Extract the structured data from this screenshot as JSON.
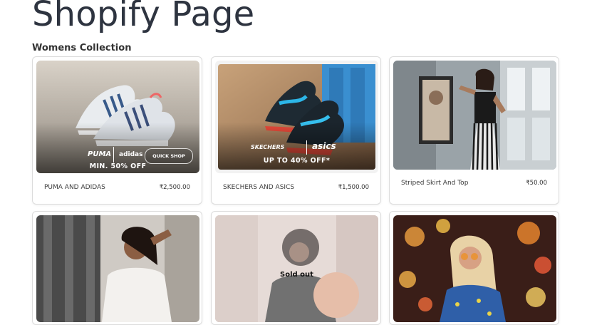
{
  "page": {
    "title": "Shopify Page",
    "section": "Womens Collection"
  },
  "products": [
    {
      "name": "PUMA AND ADIDAS",
      "price": "₹2,500.00",
      "banner": {
        "brands": [
          "PUMA",
          "adidas"
        ],
        "cta": "QUICK SHOP",
        "offer": "MIN. 50% OFF"
      }
    },
    {
      "name": "SKECHERS AND ASICS",
      "price": "₹1,500.00",
      "banner": {
        "brands": [
          "SKECHERS",
          "asics"
        ],
        "offer": "UP TO 40% OFF*"
      }
    },
    {
      "name": "Striped Skirt And Top",
      "price": "₹50.00"
    },
    {
      "name": "",
      "price": ""
    },
    {
      "name": "",
      "price": "",
      "status": "Sold out"
    },
    {
      "name": "",
      "price": ""
    }
  ],
  "colors": {
    "title": "#2e3440",
    "border": "#dcdcdc",
    "accent": "#e85a4f"
  }
}
